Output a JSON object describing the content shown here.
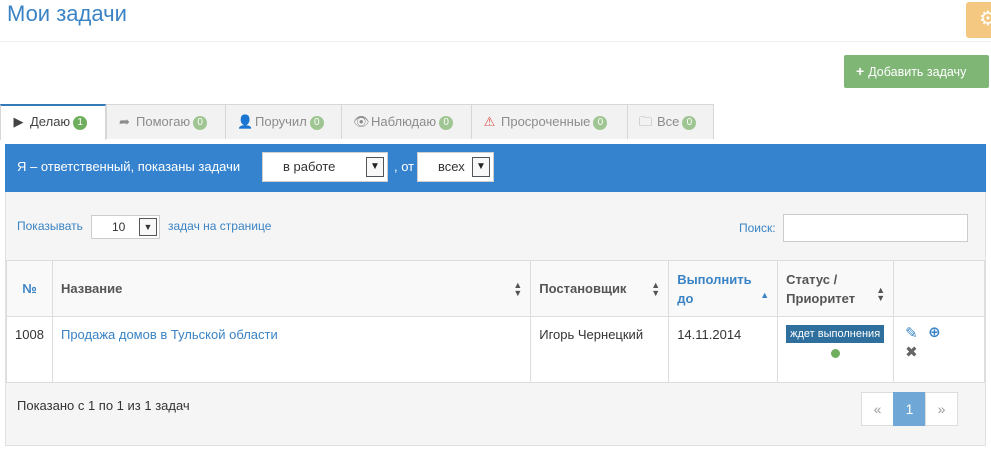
{
  "header": {
    "title": "Мои задачи",
    "settings_icon": "gear-icon",
    "add_task_label": "Добавить задачу"
  },
  "tabs": [
    {
      "label": "Делаю",
      "count": "1",
      "icon": "play-icon",
      "active": true
    },
    {
      "label": "Помогаю",
      "count": "0",
      "icon": "share-icon"
    },
    {
      "label": "Поручил",
      "count": "0",
      "icon": "user-icon"
    },
    {
      "label": "Наблюдаю",
      "count": "0",
      "icon": "eye-icon"
    },
    {
      "label": "Просроченные",
      "count": "0",
      "icon": "warning-icon"
    },
    {
      "label": "Все",
      "count": "0",
      "icon": "folder-icon"
    }
  ],
  "filter": {
    "text": "Я – ответственный, показаны задачи",
    "status_value": "в работе",
    "from_text": ", от",
    "from_value": "всех"
  },
  "table_controls": {
    "show_label": "Показывать",
    "page_length": "10",
    "per_page_label": "задач на странице",
    "search_label": "Поиск:",
    "search_value": ""
  },
  "table": {
    "columns": [
      "№",
      "Название",
      "Постановщик",
      "Выполнить до",
      "Статус / Приоритет",
      ""
    ],
    "rows": [
      {
        "num": "1008",
        "title": "Продажа домов в Тульской области",
        "author": "Игорь Чернецкий",
        "due": "14.11.2014",
        "status": "ждет выполнения",
        "priority_color": "#6fae5f"
      }
    ]
  },
  "footer": {
    "info": "Показано с 1 по 1 из 1 задач",
    "pager_prev": "«",
    "pager_current": "1",
    "pager_next": "»"
  },
  "colors": {
    "accent": "#3583cf",
    "add_button": "#7fb676",
    "badge_green": "#6fae5f",
    "status_badge": "#2e6f9e"
  }
}
